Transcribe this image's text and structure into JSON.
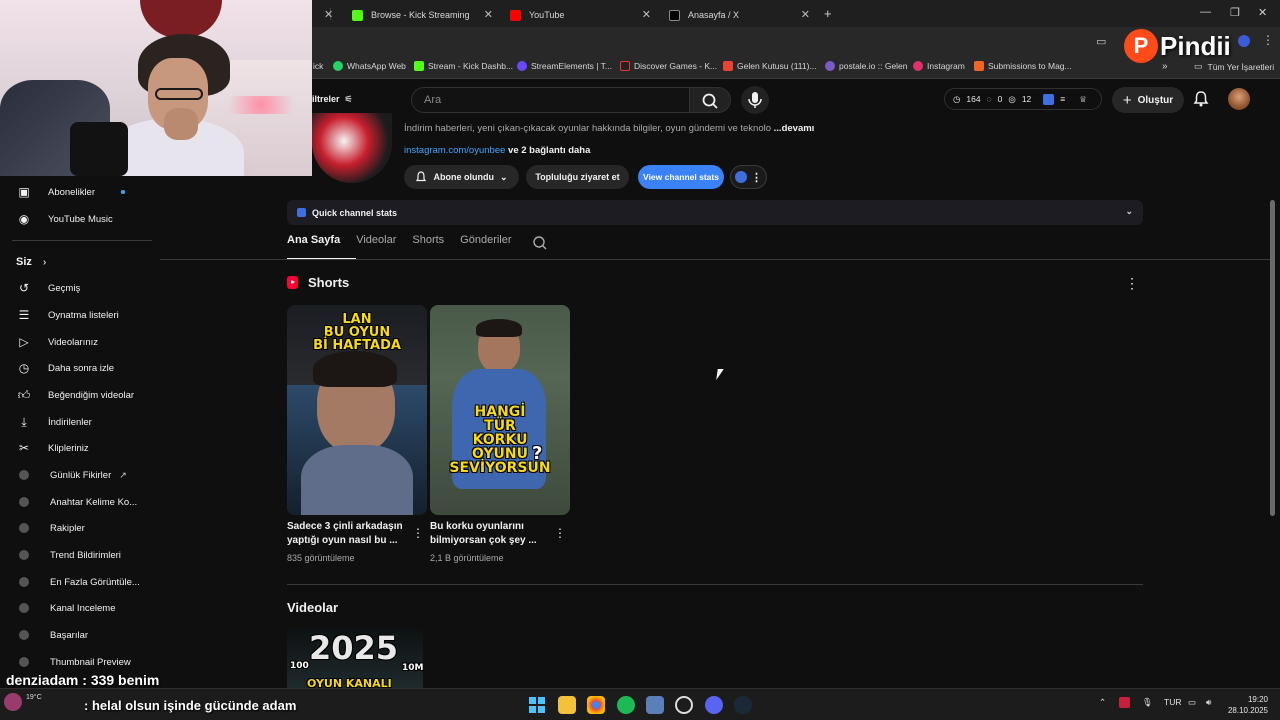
{
  "browser": {
    "tabs": [
      {
        "title": "Browse - Kick Streaming"
      },
      {
        "title": "YouTube"
      },
      {
        "title": "Anasayfa / X"
      }
    ],
    "bookmarks": [
      {
        "label": "ick"
      },
      {
        "label": "WhatsApp Web"
      },
      {
        "label": "Stream - Kick Dashb..."
      },
      {
        "label": "StreamElements | T..."
      },
      {
        "label": "Discover Games - K..."
      },
      {
        "label": "Gelen Kutusu (111)..."
      },
      {
        "label": "postale.io :: Gelen"
      },
      {
        "label": "Instagram"
      },
      {
        "label": "Submissions to Mag..."
      }
    ],
    "all_bookmarks_label": "Tüm Yer İşaretleri"
  },
  "overlay": {
    "logo_letter": "P",
    "logo_text": "Pindii",
    "chat": [
      {
        "user": "denziadam",
        "sep": " : ",
        "message": "339 benim"
      },
      {
        "user": "",
        "sep": ": ",
        "message": "helal olsun işinde gücünde adam"
      }
    ],
    "weather": "19°C"
  },
  "masthead": {
    "filters_label": "iltreler",
    "search_placeholder": "Ara",
    "stats": {
      "views": "164",
      "comments": "0",
      "subs": "12"
    },
    "create_label": "Oluştur"
  },
  "sidebar": {
    "top_items": [
      {
        "label": "Abonelikler",
        "icon": "subscriptions-icon"
      },
      {
        "label": "YouTube Music",
        "icon": "music-icon"
      }
    ],
    "siz_label": "Siz",
    "you_items": [
      {
        "label": "Geçmiş",
        "icon": "history-icon"
      },
      {
        "label": "Oynatma listeleri",
        "icon": "playlist-icon"
      },
      {
        "label": "Videolarınız",
        "icon": "your-videos-icon"
      },
      {
        "label": "Daha sonra izle",
        "icon": "clock-icon"
      },
      {
        "label": "Beğendiğim videolar",
        "icon": "like-icon"
      },
      {
        "label": "İndirilenler",
        "icon": "download-icon"
      },
      {
        "label": "Klipleriniz",
        "icon": "scissors-icon"
      }
    ],
    "extension_items": [
      {
        "label": "Günlük Fikirler"
      },
      {
        "label": "Anahtar Kelime Ko..."
      },
      {
        "label": "Rakipler"
      },
      {
        "label": "Trend Bildirimleri"
      },
      {
        "label": "En Fazla Görüntüle..."
      },
      {
        "label": "Kanal Inceleme"
      },
      {
        "label": "Başarılar"
      },
      {
        "label": "Thumbnail Preview"
      }
    ]
  },
  "channel": {
    "description": "İndirim haberleri, yeni çıkan-çıkacak oyunlar hakkında bilgiler, oyun gündemi ve teknolo",
    "more_label": "...devamı",
    "link_text": "instagram.com/oyunbee",
    "link_more": " ve 2 bağlantı daha",
    "subscribed_label": "Abone olundu",
    "community_label": "Topluluğu ziyaret et",
    "stats_button_label": "View channel stats",
    "quick_stats_label": "Quick channel stats",
    "tabs": [
      "Ana Sayfa",
      "Videolar",
      "Shorts",
      "Gönderiler"
    ]
  },
  "shorts": {
    "section_title": "Shorts",
    "items": [
      {
        "thumb_text": [
          "LAN",
          "BU OYUN",
          "Bİ HAFTADA"
        ],
        "title": "Sadece 3 çinli arkadaşın yaptığı oyun nasıl bu ...",
        "views": "835 görüntüleme"
      },
      {
        "thumb_text": [
          "HANGİ",
          "TÜR",
          "KORKU",
          "OYUNU",
          "SEVİYORSUN"
        ],
        "title": "Bu korku oyunlarını bilmiyorsan çok şey ...",
        "views": "2,1 B görüntüleme"
      }
    ]
  },
  "videos": {
    "section_title": "Videolar",
    "first_thumb": {
      "big": "2025",
      "left": "100",
      "right": "10M",
      "bottom": "OYUN KANALI"
    }
  },
  "taskbar": {
    "lang": "TUR",
    "time": "19:20",
    "date": "28.10.2025"
  }
}
